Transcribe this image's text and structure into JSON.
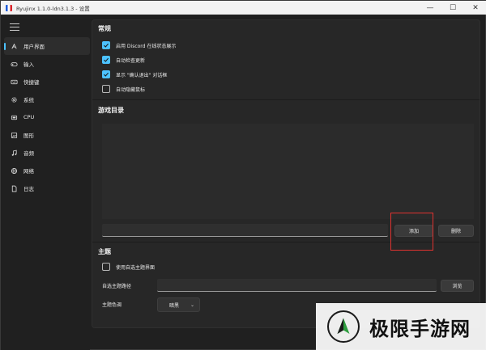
{
  "window": {
    "title": "Ryujinx 1.1.0-ldn3.1.3 - 设置",
    "controls": [
      "—",
      "☐",
      "✕"
    ]
  },
  "sidebar": {
    "items": [
      {
        "label": "用户界面",
        "icon": "ui-icon",
        "active": true
      },
      {
        "label": "输入",
        "icon": "gamepad-icon",
        "active": false
      },
      {
        "label": "快捷键",
        "icon": "keyboard-icon",
        "active": false
      },
      {
        "label": "系统",
        "icon": "gear-icon",
        "active": false
      },
      {
        "label": "CPU",
        "icon": "cpu-icon",
        "active": false
      },
      {
        "label": "图形",
        "icon": "image-icon",
        "active": false
      },
      {
        "label": "音频",
        "icon": "music-icon",
        "active": false
      },
      {
        "label": "网络",
        "icon": "globe-icon",
        "active": false
      },
      {
        "label": "日志",
        "icon": "file-icon",
        "active": false
      }
    ]
  },
  "general": {
    "heading": "常规",
    "options": [
      {
        "label": "启用 Discord 在线状态展示",
        "checked": true
      },
      {
        "label": "自动检查更新",
        "checked": true
      },
      {
        "label": "显示 \"确认退出\" 对话框",
        "checked": true
      },
      {
        "label": "自动隐藏鼠标",
        "checked": false
      }
    ]
  },
  "game_dirs": {
    "heading": "游戏目录",
    "input_value": "",
    "add_label": "添加",
    "remove_label": "删除"
  },
  "theme": {
    "heading": "主题",
    "custom_theme_label": "使用自选主题界面",
    "custom_theme_checked": false,
    "path_label": "自选主题路径",
    "path_value": "",
    "browse_label": "浏览",
    "color_label": "主题色调",
    "color_value": "暗黑"
  },
  "watermark": {
    "text": "极限手游网"
  }
}
